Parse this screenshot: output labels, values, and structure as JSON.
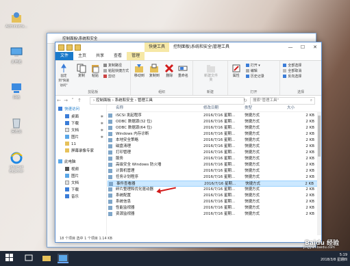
{
  "desktop": {
    "icons": [
      {
        "label": "Administra...",
        "icon": "user-folder-icon"
      },
      {
        "label": "此电脑",
        "icon": "computer-icon"
      },
      {
        "label": "网络",
        "icon": "network-icon"
      },
      {
        "label": "回收站",
        "icon": "recycle-bin-icon"
      },
      {
        "label": "Internet Explorer",
        "icon": "ie-icon"
      }
    ]
  },
  "window": {
    "quick_access_tools": [
      "save",
      "properties",
      "new-folder"
    ],
    "tool_tab": "快捷工具",
    "title": "控制面板\\系统和安全\\管理工具",
    "bg_title": "控制面板\\系统和安全",
    "controls": {
      "minimize": "—",
      "maximize": "☐",
      "close": "✕"
    }
  },
  "ribbon": {
    "tabs": [
      "文件",
      "主页",
      "共享",
      "查看",
      "管理"
    ],
    "active_tab": "管理",
    "groups": {
      "clipboard": {
        "label": "剪贴板",
        "pin": "固定到\"快速访问\"",
        "copy": "复制",
        "paste": "粘贴",
        "copy_path": "复制路径",
        "paste_shortcut": "粘贴快捷方式",
        "cut": "剪切"
      },
      "organize": {
        "label": "组织",
        "move_to": "移动到",
        "copy_to": "复制到",
        "delete": "删除",
        "rename": "重命名"
      },
      "new": {
        "label": "新建",
        "new_folder": "新建文件夹"
      },
      "open": {
        "label": "打开",
        "properties": "属性",
        "open": "打开",
        "edit": "编辑",
        "history": "历史记录"
      },
      "select": {
        "label": "选择",
        "select_all": "全部选择",
        "select_none": "全部取消",
        "invert": "反向选择"
      }
    }
  },
  "addressbar": {
    "path": [
      "控制面板",
      "系统和安全",
      "管理工具"
    ],
    "search_placeholder": "搜索\"管理工具\""
  },
  "navpane": {
    "quick_access": "快速访问",
    "items": [
      {
        "label": "桌面",
        "pinned": true,
        "icon": "desktop-folder-icon"
      },
      {
        "label": "下载",
        "pinned": true,
        "icon": "download-folder-icon"
      },
      {
        "label": "文档",
        "pinned": true,
        "icon": "documents-folder-icon"
      },
      {
        "label": "图片",
        "pinned": true,
        "icon": "pictures-folder-icon"
      },
      {
        "label": "11",
        "pinned": false,
        "icon": "folder-icon"
      },
      {
        "label": "屏幕录像专家",
        "pinned": false,
        "icon": "folder-icon"
      }
    ],
    "this_pc": "此电脑",
    "pc_items": [
      "视频",
      "图片",
      "文档",
      "下载",
      "音乐"
    ]
  },
  "filelist": {
    "columns": {
      "name": "名称",
      "date": "修改日期",
      "type": "类型",
      "size": "大小"
    },
    "rows": [
      {
        "name": "iSCSI 发起程序",
        "date": "2016/7/16 星期...",
        "type": "快捷方式",
        "size": "2 KB"
      },
      {
        "name": "ODBC 数据源(32 位)",
        "date": "2016/7/16 星期...",
        "type": "快捷方式",
        "size": "2 KB"
      },
      {
        "name": "ODBC 数据源(64 位)",
        "date": "2016/7/16 星期...",
        "type": "快捷方式",
        "size": "2 KB"
      },
      {
        "name": "Windows 内存诊断",
        "date": "2016/7/16 星期...",
        "type": "快捷方式",
        "size": "2 KB"
      },
      {
        "name": "本地安全策略",
        "date": "2016/7/16 星期...",
        "type": "快捷方式",
        "size": "2 KB"
      },
      {
        "name": "磁盘清理",
        "date": "2016/7/16 星期...",
        "type": "快捷方式",
        "size": "2 KB"
      },
      {
        "name": "打印管理",
        "date": "2016/7/16 星期...",
        "type": "快捷方式",
        "size": "2 KB"
      },
      {
        "name": "服务",
        "date": "2016/7/16 星期...",
        "type": "快捷方式",
        "size": "2 KB"
      },
      {
        "name": "高级安全 Windows 防火墙",
        "date": "2016/7/16 星期...",
        "type": "快捷方式",
        "size": "2 KB"
      },
      {
        "name": "计算机管理",
        "date": "2016/7/16 星期...",
        "type": "快捷方式",
        "size": "2 KB"
      },
      {
        "name": "任务计划程序",
        "date": "2016/7/16 星期...",
        "type": "快捷方式",
        "size": "2 KB"
      },
      {
        "name": "事件查看器",
        "date": "2016/7/16 星期...",
        "type": "快捷方式",
        "size": "2 KB",
        "selected": true
      },
      {
        "name": "碎片整理和优化驱动器",
        "date": "2016/7/16 星期...",
        "type": "快捷方式",
        "size": "2 KB"
      },
      {
        "name": "系统配置",
        "date": "2016/7/16 星期...",
        "type": "快捷方式",
        "size": "2 KB"
      },
      {
        "name": "系统信息",
        "date": "2016/7/16 星期...",
        "type": "快捷方式",
        "size": "2 KB"
      },
      {
        "name": "性能监视器",
        "date": "2016/7/16 星期...",
        "type": "快捷方式",
        "size": "2 KB"
      },
      {
        "name": "资源监视器",
        "date": "2016/7/16 星期...",
        "type": "快捷方式",
        "size": "2 KB"
      }
    ]
  },
  "status": {
    "text": "18 个项目   选中 1 个项目 1.14 KB"
  },
  "taskbar": {
    "time": "5:19",
    "date": "2018/3/8 星期四"
  },
  "watermark": {
    "brand": "Baidu 经验",
    "url": "jingyan.baidu.com"
  },
  "colors": {
    "accent": "#1979ca",
    "tool_tab": "#f6e8a6",
    "selection": "#cce8ff",
    "arrow": "#d21b1b"
  }
}
